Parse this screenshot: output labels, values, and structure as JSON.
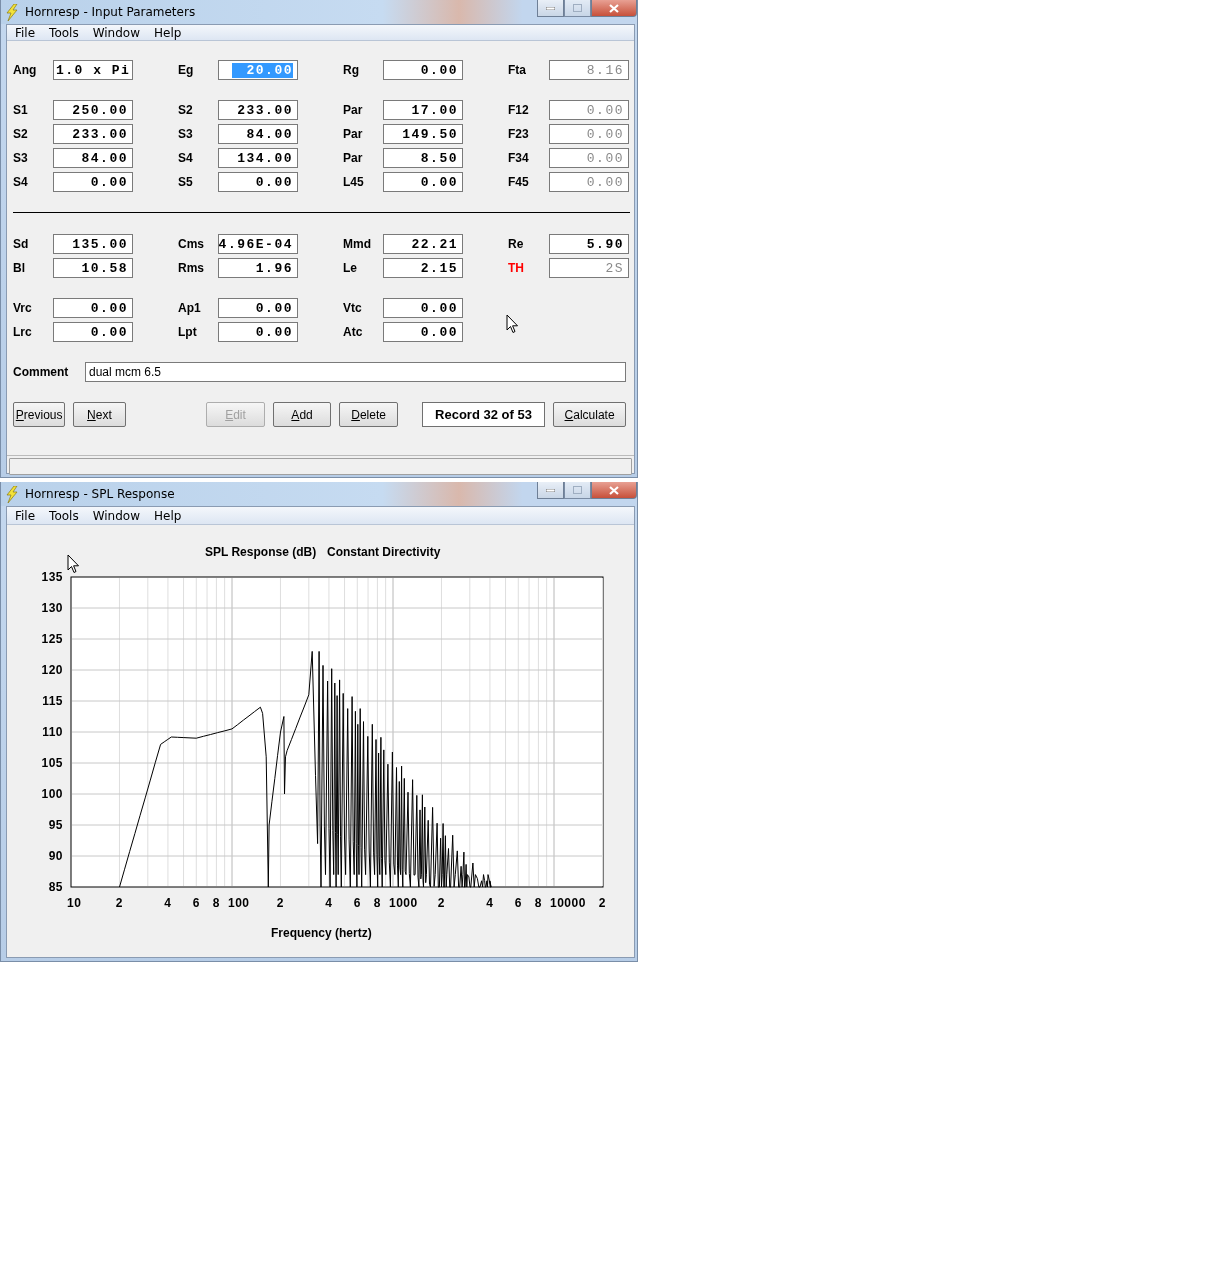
{
  "input_window": {
    "title": "Hornresp - Input Parameters",
    "menu": [
      "File",
      "Tools",
      "Window",
      "Help"
    ],
    "sections": [
      {
        "kind": "fields",
        "rows": [
          [
            {
              "label": "Ang",
              "value": "1.0 x Pi",
              "disabled": false,
              "focused": false
            },
            {
              "label": "Eg",
              "value": "20.00",
              "disabled": false,
              "focused": true
            },
            {
              "label": "Rg",
              "value": "0.00",
              "disabled": false,
              "focused": false
            },
            {
              "label": "Fta",
              "value": "8.16",
              "disabled": true,
              "focused": false
            }
          ]
        ]
      },
      {
        "kind": "fields",
        "rows": [
          [
            {
              "label": "S1",
              "value": "250.00",
              "disabled": false,
              "focused": false
            },
            {
              "label": "S2",
              "value": "233.00",
              "disabled": false,
              "focused": false
            },
            {
              "label": "Par",
              "value": "17.00",
              "disabled": false,
              "focused": false
            },
            {
              "label": "F12",
              "value": "0.00",
              "disabled": true,
              "focused": false
            }
          ],
          [
            {
              "label": "S2",
              "value": "233.00",
              "disabled": false,
              "focused": false
            },
            {
              "label": "S3",
              "value": "84.00",
              "disabled": false,
              "focused": false
            },
            {
              "label": "Par",
              "value": "149.50",
              "disabled": false,
              "focused": false
            },
            {
              "label": "F23",
              "value": "0.00",
              "disabled": true,
              "focused": false
            }
          ],
          [
            {
              "label": "S3",
              "value": "84.00",
              "disabled": false,
              "focused": false
            },
            {
              "label": "S4",
              "value": "134.00",
              "disabled": false,
              "focused": false
            },
            {
              "label": "Par",
              "value": "8.50",
              "disabled": false,
              "focused": false
            },
            {
              "label": "F34",
              "value": "0.00",
              "disabled": true,
              "focused": false
            }
          ],
          [
            {
              "label": "S4",
              "value": "0.00",
              "disabled": false,
              "focused": false
            },
            {
              "label": "S5",
              "value": "0.00",
              "disabled": false,
              "focused": false
            },
            {
              "label": "L45",
              "value": "0.00",
              "disabled": false,
              "focused": false
            },
            {
              "label": "F45",
              "value": "0.00",
              "disabled": true,
              "focused": false
            }
          ]
        ]
      },
      {
        "kind": "divider"
      },
      {
        "kind": "fields",
        "rows": [
          [
            {
              "label": "Sd",
              "value": "135.00",
              "disabled": false,
              "focused": false
            },
            {
              "label": "Cms",
              "value": "4.96E-04",
              "disabled": false,
              "focused": false
            },
            {
              "label": "Mmd",
              "value": "22.21",
              "disabled": false,
              "focused": false
            },
            {
              "label": "Re",
              "value": "5.90",
              "disabled": false,
              "focused": false
            }
          ],
          [
            {
              "label": "Bl",
              "value": "10.58",
              "disabled": false,
              "focused": false
            },
            {
              "label": "Rms",
              "value": "1.96",
              "disabled": false,
              "focused": false
            },
            {
              "label": "Le",
              "value": "2.15",
              "disabled": false,
              "focused": false
            },
            {
              "label": "TH",
              "value": "2S",
              "disabled": true,
              "focused": false,
              "color": "#ff0000"
            }
          ]
        ]
      },
      {
        "kind": "fields",
        "rows": [
          [
            {
              "label": "Vrc",
              "value": "0.00",
              "disabled": false,
              "focused": false
            },
            {
              "label": "Ap1",
              "value": "0.00",
              "disabled": false,
              "focused": false
            },
            {
              "label": "Vtc",
              "value": "0.00",
              "disabled": false,
              "focused": false
            }
          ],
          [
            {
              "label": "Lrc",
              "value": "0.00",
              "disabled": false,
              "focused": false
            },
            {
              "label": "Lpt",
              "value": "0.00",
              "disabled": false,
              "focused": false
            },
            {
              "label": "Atc",
              "value": "0.00",
              "disabled": false,
              "focused": false
            }
          ]
        ]
      }
    ],
    "comment": {
      "label": "Comment",
      "value": "dual mcm 6.5"
    },
    "buttons": [
      {
        "kind": "button",
        "label": "Previous",
        "disabled": false
      },
      {
        "kind": "button",
        "label": "Next",
        "disabled": false
      },
      {
        "kind": "spacer"
      },
      {
        "kind": "button",
        "label": "Edit",
        "disabled": true
      },
      {
        "kind": "button",
        "label": "Add",
        "disabled": false
      },
      {
        "kind": "button",
        "label": "Delete",
        "disabled": false
      },
      {
        "kind": "record",
        "label": "Record 32 of 53"
      },
      {
        "kind": "button",
        "label": "Calculate",
        "disabled": false
      }
    ]
  },
  "spl_window": {
    "title": "Hornresp - SPL Response",
    "menu": [
      "File",
      "Tools",
      "Window",
      "Help"
    ],
    "chart": {
      "title": "SPL Response (dB)",
      "subtitle": "Constant Directivity",
      "xlabel": "Frequency (hertz)",
      "yticks": [
        "135",
        "130",
        "125",
        "120",
        "115",
        "110",
        "105",
        "100",
        "95",
        "90",
        "85"
      ],
      "xticks": [
        "10",
        "2",
        "4",
        "6",
        "8",
        "100",
        "2",
        "4",
        "6",
        "8",
        "1000",
        "2",
        "4",
        "6",
        "8",
        "10000",
        "2"
      ]
    }
  }
}
